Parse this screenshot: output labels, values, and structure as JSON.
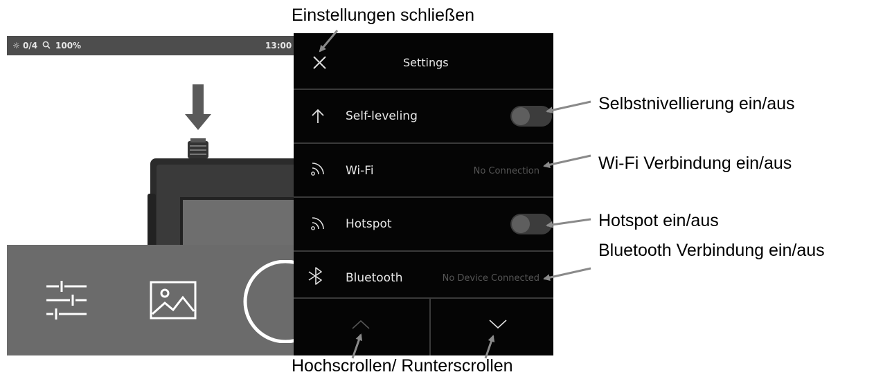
{
  "annotations": {
    "close_settings": "Einstellungen schließen",
    "self_leveling": "Selbstnivellierung ein/aus",
    "wifi": "Wi-Fi Verbindung ein/aus",
    "hotspot": "Hotspot ein/aus",
    "bluetooth": "Bluetooth Verbindung ein/aus",
    "scroll": "Hochscrollen/ Runterscrollen"
  },
  "status_bar": {
    "brightness": "0/4",
    "zoom": "100%",
    "time": "13:00",
    "icons": [
      "brightness-icon",
      "zoom-icon"
    ]
  },
  "toolbar": {
    "icons": [
      "sliders-icon",
      "gallery-icon",
      "shutter-button"
    ]
  },
  "settings": {
    "title": "Settings",
    "items": [
      {
        "icon": "arrow-up-icon",
        "label": "Self-leveling",
        "control": "toggle",
        "on": false
      },
      {
        "icon": "wifi-icon",
        "label": "Wi-Fi",
        "status": "No Connection"
      },
      {
        "icon": "wifi-icon",
        "label": "Hotspot",
        "control": "toggle",
        "on": false
      },
      {
        "icon": "bluetooth-icon",
        "label": "Bluetooth",
        "status": "No Device Connected"
      }
    ],
    "scroll_icons": [
      "chevron-up-icon",
      "chevron-down-icon"
    ]
  },
  "colors": {
    "panel_bg": "#050505",
    "status_bar_bg": "#4d4d4d",
    "toolbar_bg": "#6b6b6b",
    "device_arrow": "#5a5a5a"
  }
}
